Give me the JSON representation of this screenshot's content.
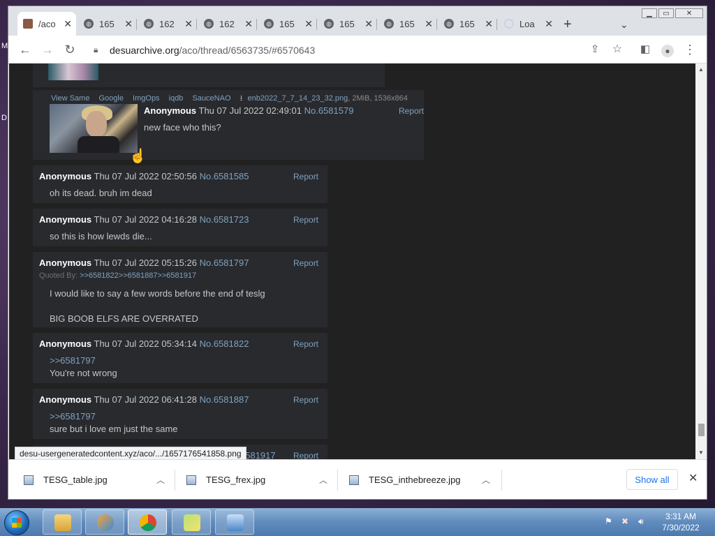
{
  "desktop": {
    "letters": [
      "M",
      "D"
    ]
  },
  "browser": {
    "tabs": [
      {
        "label": "/aco",
        "active": true
      },
      {
        "label": "165"
      },
      {
        "label": "162"
      },
      {
        "label": "162"
      },
      {
        "label": "165"
      },
      {
        "label": "165"
      },
      {
        "label": "165"
      },
      {
        "label": "165"
      },
      {
        "label": "Loa",
        "loading": true
      }
    ],
    "url_host": "desuarchive.org",
    "url_path": "/aco/thread/6563735/#6570643"
  },
  "thread": {
    "op_post": {
      "file_links": [
        "View Same",
        "Google",
        "ImgOps",
        "iqdb",
        "SauceNAO"
      ],
      "file_name": "enb2022_7_7_14_23_32.png",
      "file_meta": ", 2MiB, 1536x864",
      "name": "Anonymous",
      "date": "Thu 07 Jul 2022 02:49:01",
      "number": "No.6581579",
      "report": "Report",
      "text": "new face who this?"
    },
    "posts": [
      {
        "name": "Anonymous",
        "date": "Thu 07 Jul 2022 02:50:56",
        "number": "No.6581585",
        "report": "Report",
        "lines": [
          "oh its dead. bruh im dead"
        ]
      },
      {
        "name": "Anonymous",
        "date": "Thu 07 Jul 2022 04:16:28",
        "number": "No.6581723",
        "report": "Report",
        "lines": [
          "so this is how lewds die..."
        ]
      },
      {
        "name": "Anonymous",
        "date": "Thu 07 Jul 2022 05:15:26",
        "number": "No.6581797",
        "report": "Report",
        "quoted_by_label": "Quoted By:",
        "quoted_by": [
          ">>6581822",
          ">>6581887",
          ">>6581917"
        ],
        "lines": [
          "I would like to say a few words before the end of teslg",
          "BIG BOOB ELFS ARE OVERRATED"
        ]
      },
      {
        "name": "Anonymous",
        "date": "Thu 07 Jul 2022 05:34:14",
        "number": "No.6581822",
        "report": "Report",
        "quote": ">>6581797",
        "lines": [
          "You're not wrong"
        ]
      },
      {
        "name": "Anonymous",
        "date": "Thu 07 Jul 2022 06:41:28",
        "number": "No.6581887",
        "report": "Report",
        "quote": ">>6581797",
        "lines": [
          "sure but i love em just the same"
        ]
      },
      {
        "number_partial": "6581917",
        "report": "Report"
      }
    ]
  },
  "status_url": "desu-usergeneratedcontent.xyz/aco/.../1657176541858.png",
  "downloads": {
    "items": [
      "TESG_table.jpg",
      "TESG_frex.jpg",
      "TESG_inthebreeze.jpg"
    ],
    "show_all": "Show all"
  },
  "taskbar": {
    "time": "3:31 AM",
    "date": "7/30/2022"
  },
  "colors": {
    "page_bg": "#212121",
    "post_bg": "#282a2e",
    "link": "#81a2be"
  }
}
